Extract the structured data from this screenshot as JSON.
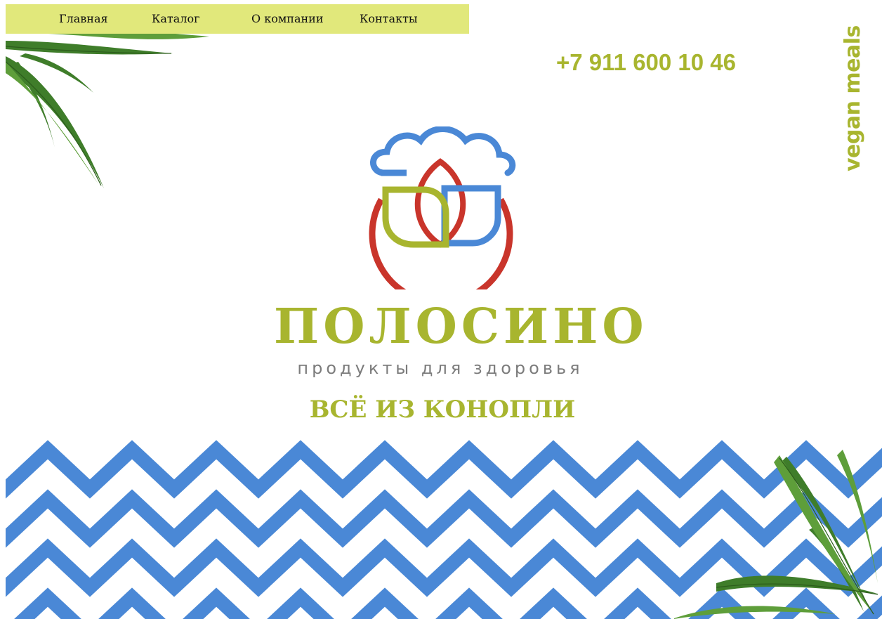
{
  "nav": {
    "items": [
      {
        "label": "Главная"
      },
      {
        "label": "Каталог"
      },
      {
        "label": "О компании"
      },
      {
        "label": "Контакты"
      }
    ]
  },
  "header": {
    "phone": "+7 911 600 10 46",
    "vertical_label": "vegan meals"
  },
  "hero": {
    "brand": "ПОЛОСИНО",
    "tagline": "продукты для здоровья",
    "headline": "ВСЁ ИЗ КОНОПЛИ"
  },
  "colors": {
    "nav_bg": "#e1e87b",
    "accent_green": "#a8b52f",
    "logo_blue": "#4a88d6",
    "logo_red": "#c9352b",
    "zigzag_blue": "#4a88d6",
    "tagline_gray": "#7c7c7c"
  },
  "icons": {
    "logo": "lotus-cloud-logo-icon",
    "leaf": "hemp-leaf-icon"
  }
}
